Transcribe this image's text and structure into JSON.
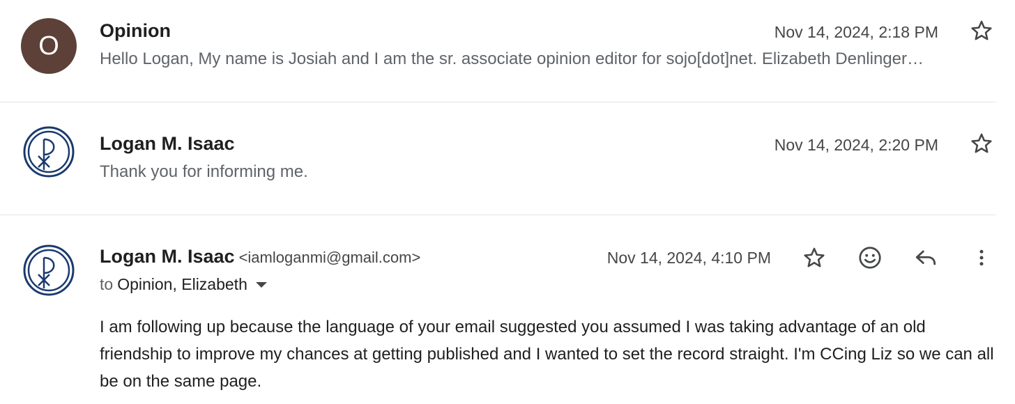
{
  "messages": [
    {
      "avatar_letter": "O",
      "avatar_color": "#5d4037",
      "sender": "Opinion",
      "date": "Nov 14, 2024, 2:18 PM",
      "snippet": "Hello Logan, My name is Josiah and I am the sr. associate opinion editor for sojo[dot]net. Elizabeth Denlinger…"
    },
    {
      "avatar_icon": "chi-rho-logo-icon",
      "sender": "Logan M. Isaac",
      "date": "Nov 14, 2024, 2:20 PM",
      "snippet": "Thank you for informing me."
    },
    {
      "avatar_icon": "chi-rho-logo-icon",
      "sender": "Logan M. Isaac",
      "email": "<iamloganmi@gmail.com>",
      "date": "Nov 14, 2024, 4:10 PM",
      "to_label": "to",
      "to_names": "Opinion, Elizabeth",
      "body": "I am following up because the language of your email suggested you assumed I was taking advantage of an old friendship to improve my chances at getting published and I wanted to set the record straight. I'm CCing Liz so we can all be on the same page."
    }
  ],
  "icons": {
    "star": "star-icon",
    "emoji": "emoji-icon",
    "reply": "reply-icon",
    "more": "more-vert-icon"
  },
  "colors": {
    "logo_blue": "#1a3a6e",
    "divider": "#e3e3e3"
  }
}
